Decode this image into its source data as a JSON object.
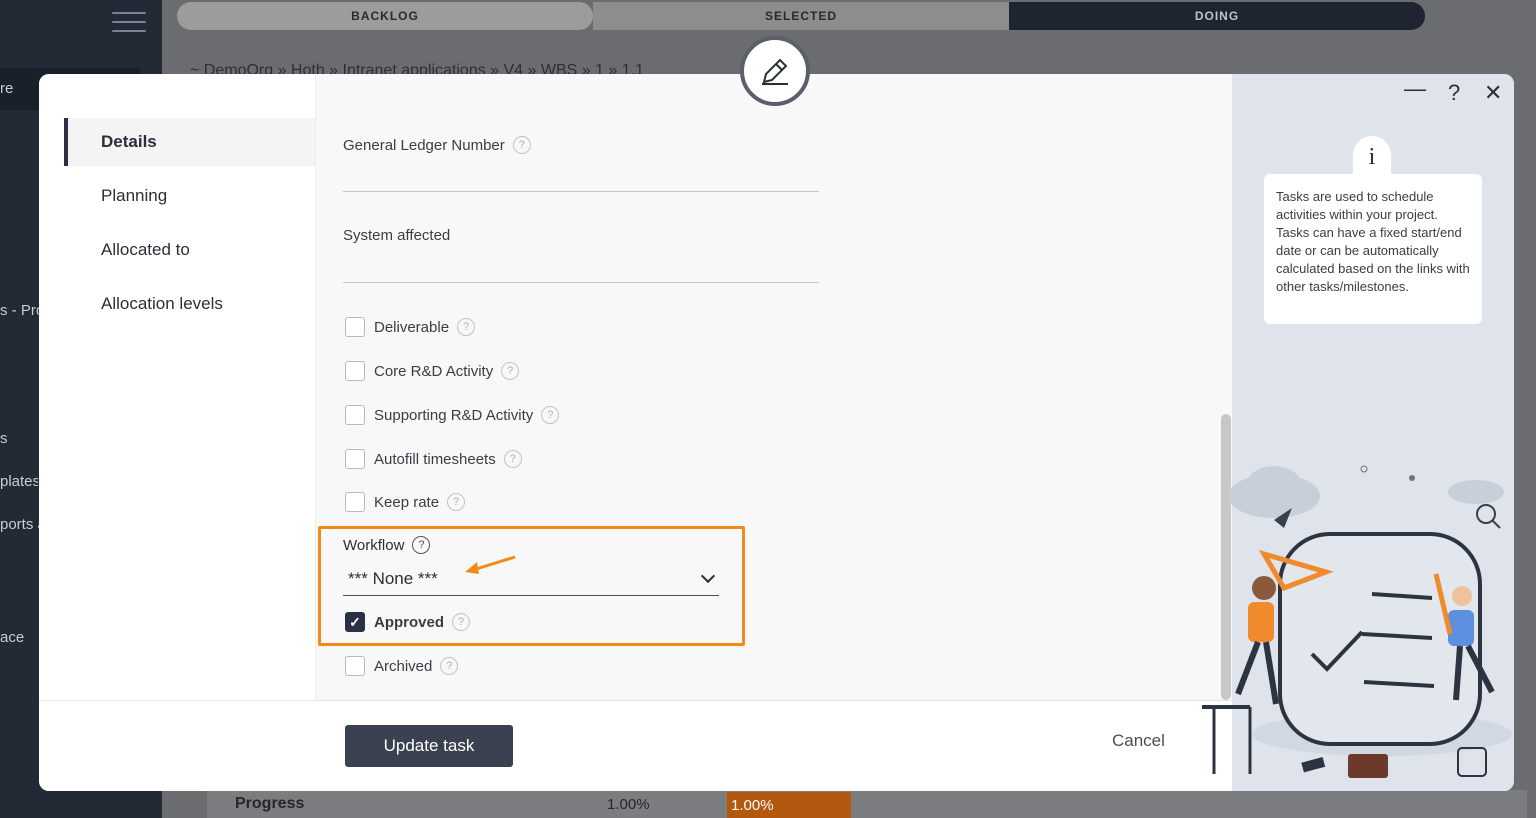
{
  "background": {
    "stages": [
      "BACKLOG",
      "SELECTED",
      "DOING"
    ],
    "breadcrumb": "~ DemoOrg  »  Hoth  »  Intranet applications  »  V4  »  WBS  »  1  »  1.1",
    "sidebar_items": [
      "re",
      "s - Pro",
      "s",
      "plates",
      "ports a",
      "ace"
    ],
    "bottom_row": {
      "label": "Progress",
      "value": "1.00%",
      "bar_value": "1.00%",
      "bar_progress": 1
    }
  },
  "modal": {
    "nav": [
      "Details",
      "Planning",
      "Allocated to",
      "Allocation levels"
    ],
    "fields": {
      "gl_number_label": "General Ledger Number",
      "system_affected_label": "System affected"
    },
    "checkboxes": [
      {
        "label": "Deliverable",
        "checked": false
      },
      {
        "label": "Core R&D Activity",
        "checked": false
      },
      {
        "label": "Supporting R&D Activity",
        "checked": false
      },
      {
        "label": "Autofill timesheets",
        "checked": false
      },
      {
        "label": "Keep rate",
        "checked": false
      }
    ],
    "workflow": {
      "label": "Workflow",
      "value": "*** None ***"
    },
    "approved": {
      "label": "Approved",
      "checked": true,
      "mark": "✓"
    },
    "archived": {
      "label": "Archived",
      "checked": false
    },
    "footer": {
      "update_label": "Update task",
      "cancel_label": "Cancel"
    },
    "help_panel": {
      "minimize": "—",
      "help": "?",
      "close": "✕",
      "info_icon": "i",
      "text": "Tasks are used to schedule activities within your project. Tasks can have a fixed start/end date or can be automatically calculated based on the links with other tasks/milestones."
    },
    "help_glyph": "?"
  },
  "colors": {
    "accent": "#f28a19",
    "primary": "#3b4150",
    "progress": "#b3580f"
  }
}
